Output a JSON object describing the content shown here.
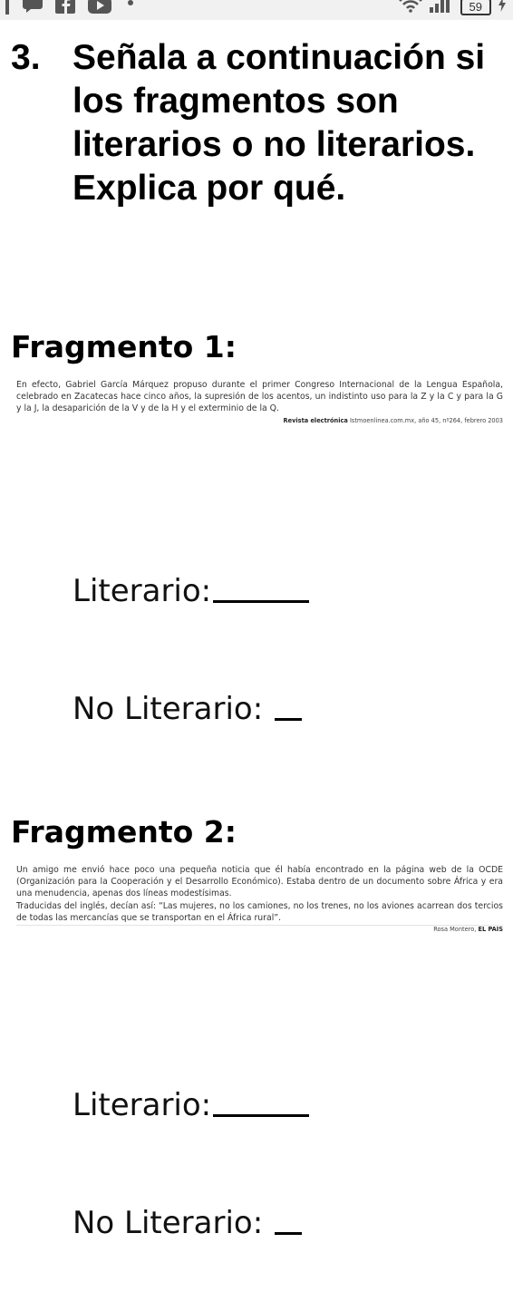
{
  "status_bar": {
    "icons": [
      "signal-bar-icon",
      "chat-icon",
      "facebook-icon",
      "youtube-icon",
      "dot-icon",
      "wifi-icon",
      "cell-signal-icon",
      "charging-icon"
    ],
    "battery": "59"
  },
  "question": {
    "number": "3.",
    "text": "Señala a continuación si los fragmentos son literarios o no literarios. Explica por qué."
  },
  "fragment1": {
    "title": "Fragmento 1:",
    "paragraph": "En efecto, Gabriel García Márquez propuso durante el primer Congreso Internacional de la Lengua Española, celebrado en Zacatecas hace cinco años, la supresión de los acentos, un indistinto uso para la Z y la C y para la G y la J, la desaparición de la V y de la H y el exterminio de la Q.",
    "source_name": "Revista electrónica",
    "source_detail": "Istmoenlinea.com.mx, año 45, nº264, febrero 2003",
    "literario_label": "Literario:",
    "no_literario_label": "No Literario:"
  },
  "fragment2": {
    "title": "Fragmento 2:",
    "paragraph1": "Un amigo me envió hace poco una pequeña noticia que él había encontrado en la página web de la OCDE (Organización para la Cooperación y el Desarrollo Económico). Estaba dentro de un documento sobre África y era una menudencia, apenas dos líneas modestísimas.",
    "paragraph2": "Traducidas del inglés, decían así: “Las mujeres, no los camiones, no los trenes, no los aviones acarrean dos tercios de todas las mercancías que se transportan en el África rural”.",
    "source_name": "Rosa Montero,",
    "source_detail": "EL PAÍS",
    "literario_label": "Literario:",
    "no_literario_label": "No Literario:"
  }
}
